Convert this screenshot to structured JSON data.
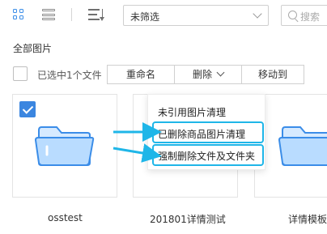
{
  "toolbar": {
    "view_grid_icon": "grid-view-icon",
    "view_list_icon": "list-view-icon",
    "sort_icon": "sort-icon",
    "filter_value": "未筛选",
    "search_placeholder": "搜索"
  },
  "section": {
    "title": "全部图片"
  },
  "selection": {
    "text": "已选中1个文件",
    "rename_label": "重命名",
    "delete_label": "删除",
    "move_label": "移动到"
  },
  "delete_menu": {
    "items": [
      "未引用图片清理",
      "已删除商品图片清理",
      "强制删除文件及文件夹"
    ]
  },
  "folders": [
    {
      "name": "osstest",
      "selected": true
    },
    {
      "name": "201801详情测试",
      "selected": false
    },
    {
      "name": "详情模板",
      "selected": false
    }
  ],
  "colors": {
    "accent": "#3b86e0",
    "highlight": "#1fb6e8",
    "folder_fill": "#b9dcff",
    "folder_stroke": "#3b8de8"
  }
}
